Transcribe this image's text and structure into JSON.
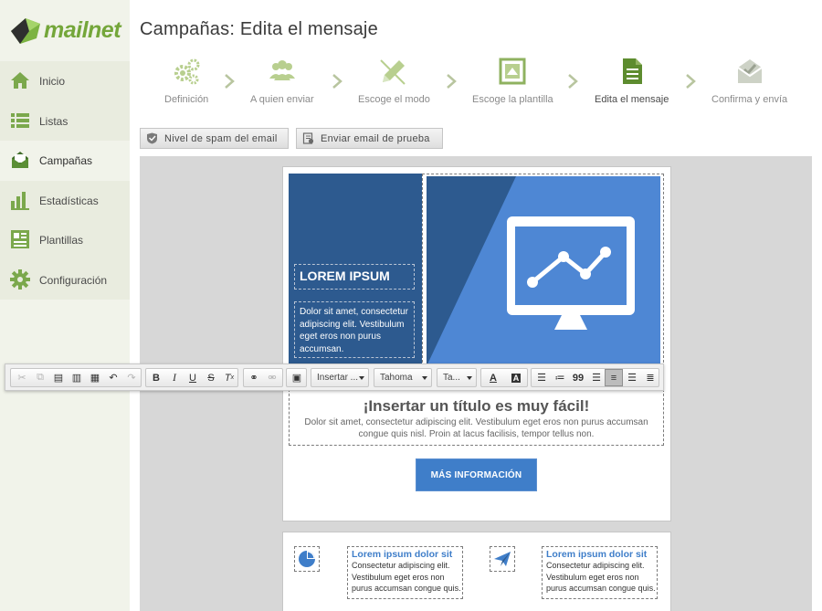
{
  "brand": {
    "name": "mailnet",
    "color": "#74a63a"
  },
  "sidebar": {
    "items": [
      {
        "label": "Inicio",
        "icon": "home-icon",
        "active": false
      },
      {
        "label": "Listas",
        "icon": "list-icon",
        "active": false
      },
      {
        "label": "Campañas",
        "icon": "campaign-envelope-icon",
        "active": true
      },
      {
        "label": "Estadísticas",
        "icon": "bar-chart-icon",
        "active": false
      },
      {
        "label": "Plantillas",
        "icon": "template-icon",
        "active": false
      },
      {
        "label": "Configuración",
        "icon": "gear-icon",
        "active": false
      }
    ]
  },
  "header": {
    "title": "Campañas: Edita el mensaje"
  },
  "steps": [
    {
      "label": "Definición",
      "icon": "gears-icon",
      "active": false
    },
    {
      "label": "A quien enviar",
      "icon": "users-icon",
      "active": false
    },
    {
      "label": "Escoge el modo",
      "icon": "pencil-icon",
      "active": false
    },
    {
      "label": "Escoge la plantilla",
      "icon": "template-frame-icon",
      "active": false
    },
    {
      "label": "Edita el mensaje",
      "icon": "document-icon",
      "active": true
    },
    {
      "label": "Confirma y envía",
      "icon": "envelope-check-icon",
      "active": false
    }
  ],
  "actions": {
    "spam_label": "Nivel de spam del email",
    "test_label": "Enviar email de prueba"
  },
  "email": {
    "hero": {
      "title": "LOREM IPSUM",
      "text": "Dolor sit amet, consectetur adipiscing elit. Vestibulum eget eros non purus accumsan."
    },
    "section": {
      "title": "¡Insertar un título es muy fácil!",
      "text": "Dolor sit amet, consectetur adipiscing elit. Vestibulum eget eros non purus accumsan congue quis nisl. Proin at lacus facilisis, tempor tellus non."
    },
    "cta_label": "MÁS INFORMACIÓN",
    "features": [
      {
        "title": "Lorem ipsum dolor sit",
        "text": "Consectetur adipiscing elit. Vestibulum eget eros non purus accumsan congue quis."
      },
      {
        "title": "Lorem ipsum dolor sit",
        "text": "Consectetur adipiscing elit. Vestibulum eget eros non purus accumsan congue quis."
      }
    ]
  },
  "editor_toolbar": {
    "insert_label": "Insertar ...",
    "font_label": "Tahoma",
    "size_label": "Ta...",
    "text_color_glyph": "A",
    "bg_color_glyph": "A",
    "blockquote_glyph": "99"
  },
  "colors": {
    "accent_green": "#74a63a",
    "hero_dark_blue": "#2d5a8f",
    "hero_light_blue": "#4e87d4",
    "cta_blue": "#3f7ec9"
  }
}
